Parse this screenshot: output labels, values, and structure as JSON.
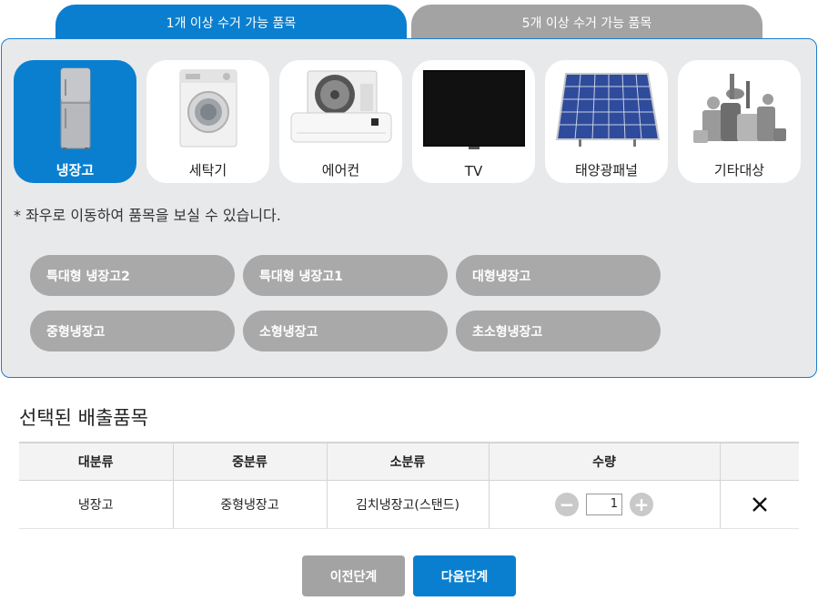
{
  "tabs": [
    {
      "label": "1개 이상 수거 가능 품목",
      "active": true
    },
    {
      "label": "5개 이상 수거 가능 품목",
      "active": false
    }
  ],
  "categories": [
    {
      "label": "냉장고",
      "icon": "refrigerator-icon",
      "selected": true
    },
    {
      "label": "세탁기",
      "icon": "washing-machine-icon",
      "selected": false
    },
    {
      "label": "에어컨",
      "icon": "air-conditioner-icon",
      "selected": false
    },
    {
      "label": "TV",
      "icon": "tv-icon",
      "selected": false
    },
    {
      "label": "태양광패널",
      "icon": "solar-panel-icon",
      "selected": false
    },
    {
      "label": "기타대상",
      "icon": "misc-appliances-icon",
      "selected": false
    }
  ],
  "hint": "* 좌우로 이동하여 품목을 보실 수 있습니다.",
  "subcategories": [
    "특대형 냉장고2",
    "특대형 냉장고1",
    "대형냉장고",
    "중형냉장고",
    "소형냉장고",
    "초소형냉장고"
  ],
  "selected_section": {
    "title": "선택된 배출품목",
    "headers": [
      "대분류",
      "중분류",
      "소분류",
      "수량",
      ""
    ],
    "rows": [
      {
        "major": "냉장고",
        "middle": "중형냉장고",
        "minor": "김치냉장고(스탠드)",
        "quantity": "1"
      }
    ],
    "minus_symbol": "−",
    "plus_symbol": "+"
  },
  "buttons": {
    "prev": "이전단계",
    "next": "다음단계"
  },
  "colors": {
    "accent": "#0a7fcf",
    "inactive": "#a3a3a3",
    "panel_bg": "#e8e9eb"
  }
}
